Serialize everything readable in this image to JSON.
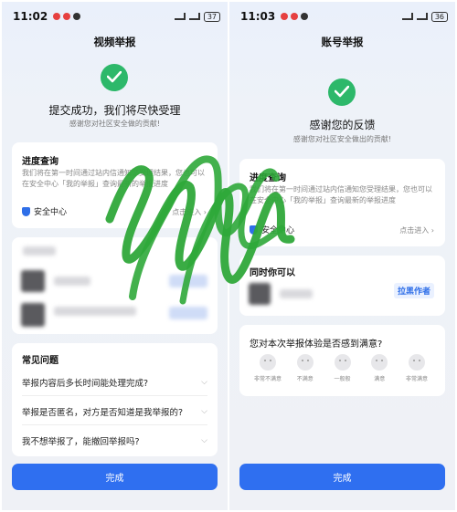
{
  "left": {
    "status": {
      "time": "11:02",
      "battery": "37"
    },
    "title": "视频举报",
    "headline": "提交成功，我们将尽快受理",
    "subtitle": "感谢您对社区安全做的贡献!",
    "progress": {
      "title": "进度查询",
      "body": "我们将在第一时间通过站内信通知您受理结果，您也可以在安全中心「我的举报」查询最新的举报进度",
      "security_center": "安全中心",
      "enter": "点击进入 ›"
    },
    "faq": {
      "title": "常见问题",
      "items": [
        "举报内容后多长时间能处理完成?",
        "举报是否匿名，对方是否知道是我举报的?",
        "我不想举报了，能撤回举报吗?"
      ]
    },
    "done_label": "完成"
  },
  "right": {
    "status": {
      "time": "11:03",
      "battery": "36"
    },
    "title": "账号举报",
    "headline": "感谢您的反馈",
    "subtitle": "感谢您对社区安全做出的贡献!",
    "progress": {
      "title": "进度查询",
      "body": "我们将在第一时间通过站内信通知您受理结果，您也可以在安全中心「我的举报」查询最新的举报进度",
      "security_center": "安全中心",
      "enter": "点击进入 ›"
    },
    "block": {
      "title": "同时你可以",
      "button": "拉黑作者"
    },
    "rating": {
      "question": "您对本次举报体验是否感到满意?",
      "options": [
        "非常不满意",
        "不满意",
        "一般般",
        "满意",
        "非常满意"
      ]
    },
    "done_label": "完成"
  },
  "colors": {
    "accent": "#2f6ff0",
    "success": "#2db86a",
    "scribble": "#2fa83a"
  }
}
